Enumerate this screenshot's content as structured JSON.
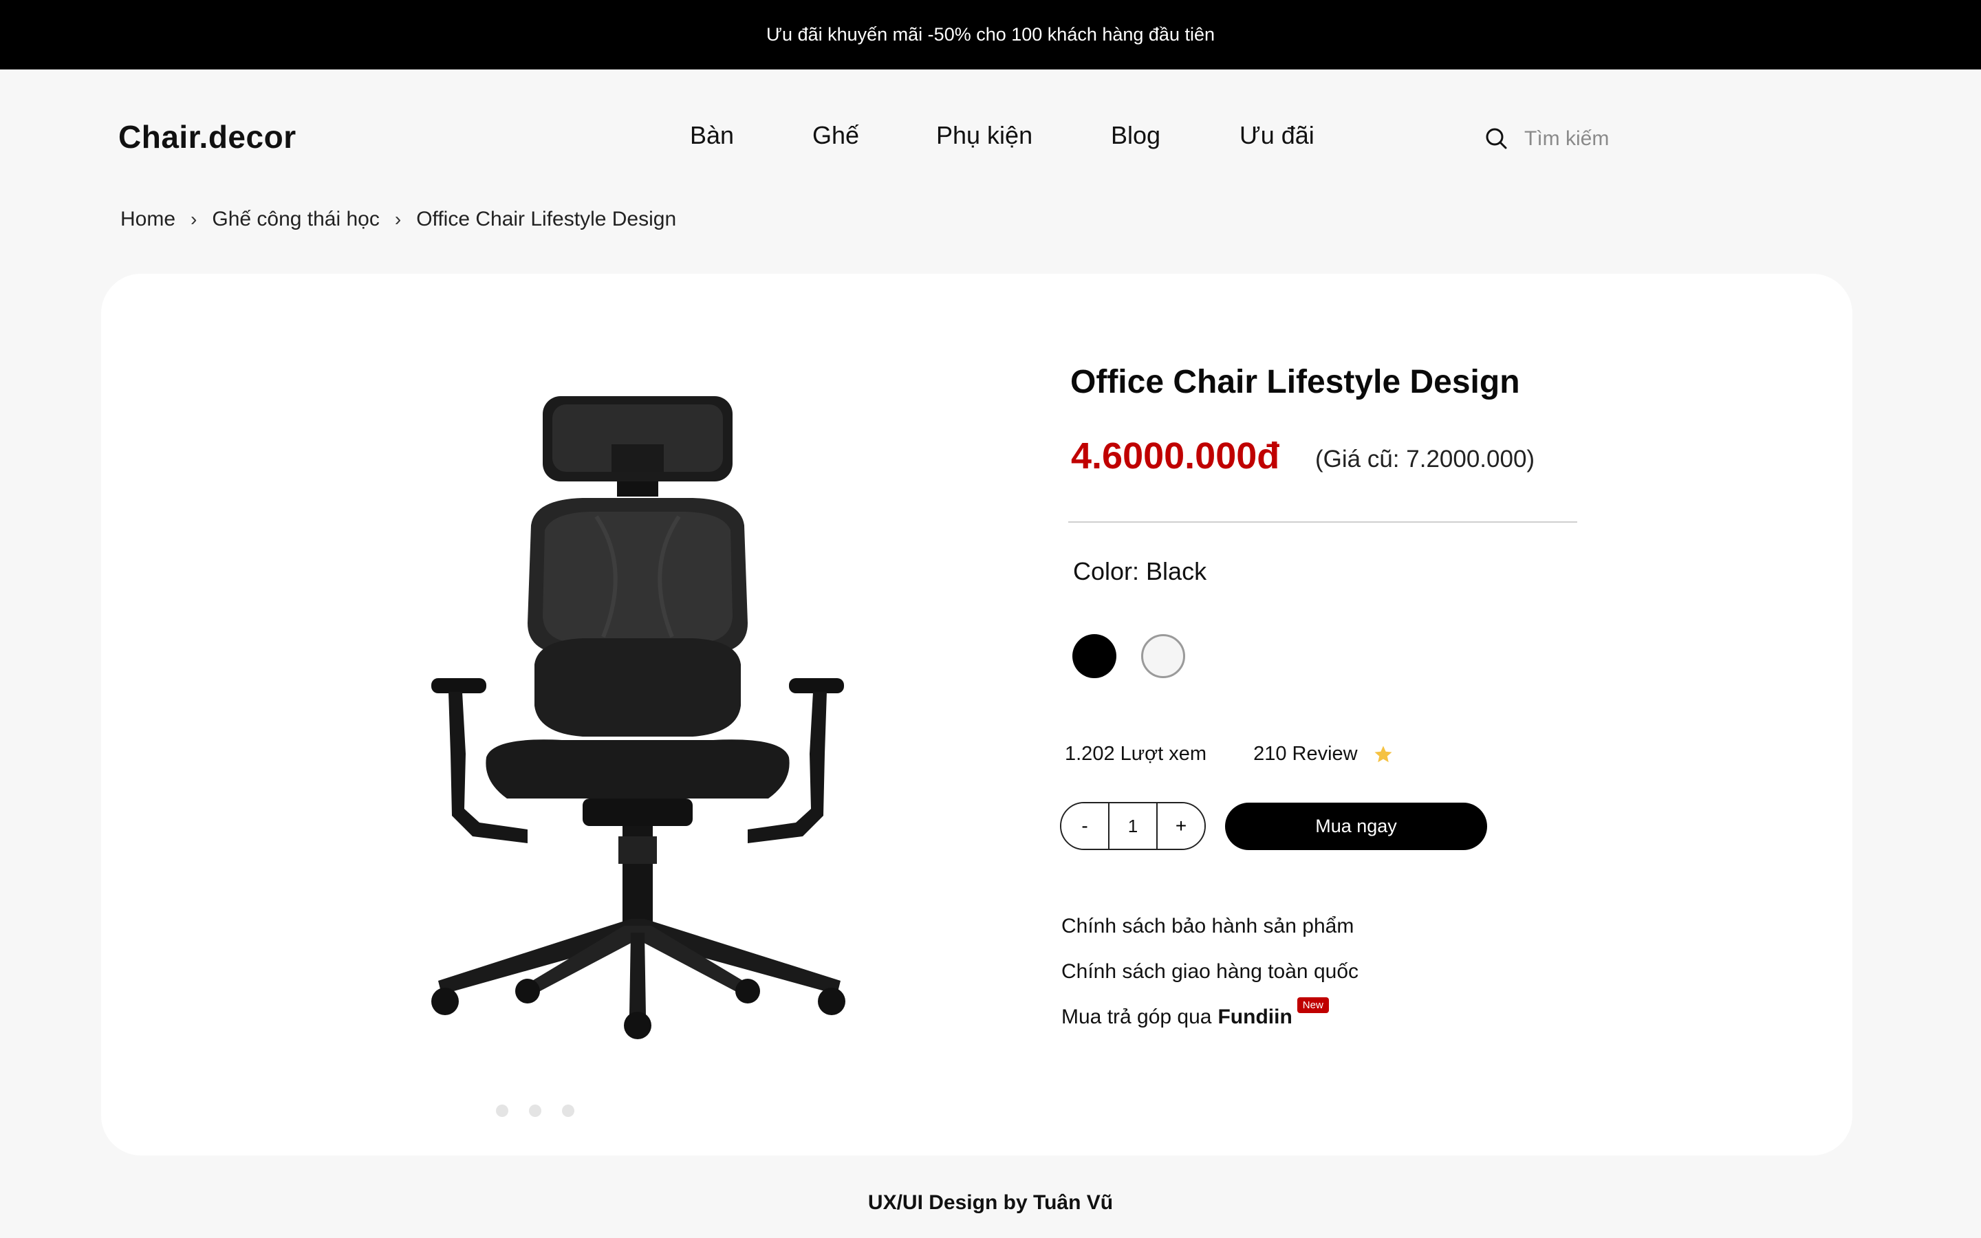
{
  "promo_bar": {
    "text": "Ưu đãi khuyến mãi -50% cho 100 khách hàng đầu tiên"
  },
  "header": {
    "logo": "Chair.decor",
    "nav": [
      "Bàn",
      "Ghế",
      "Phụ kiện",
      "Blog",
      "Ưu đãi"
    ],
    "search_placeholder": "Tìm kiếm",
    "search_icon": "search-icon"
  },
  "breadcrumb": [
    "Home",
    "Ghế công thái học",
    "Office Chair Lifestyle Design"
  ],
  "product": {
    "title": "Office Chair Lifestyle Design",
    "price": "4.6000.000đ",
    "old_price": "(Giá cũ: 7.2000.000)",
    "color_label": "Color: Black",
    "colors": [
      {
        "name": "Black",
        "hex": "#000000",
        "selected": true
      },
      {
        "name": "White",
        "hex": "#f5f5f5",
        "selected": false
      }
    ],
    "views": "1.202 Lượt xem",
    "reviews": "210 Review",
    "star_color": "#f5c242",
    "quantity": {
      "minus": "-",
      "value": "1",
      "plus": "+"
    },
    "buy_label": "Mua ngay",
    "image_dots": 3,
    "image_icon": "office-chair-image"
  },
  "policies": {
    "warranty": "Chính sách bảo hành sản phẩm",
    "shipping": "Chính sách giao hàng toàn quốc",
    "installment_prefix": "Mua trả góp qua",
    "installment_brand": "Fundiin",
    "new_badge": "New"
  },
  "footer": {
    "credit": "UX/UI Design by Tuân Vũ"
  },
  "theme": {
    "accent": "#c00000",
    "dark": "#000000",
    "background": "#f7f7f7"
  }
}
